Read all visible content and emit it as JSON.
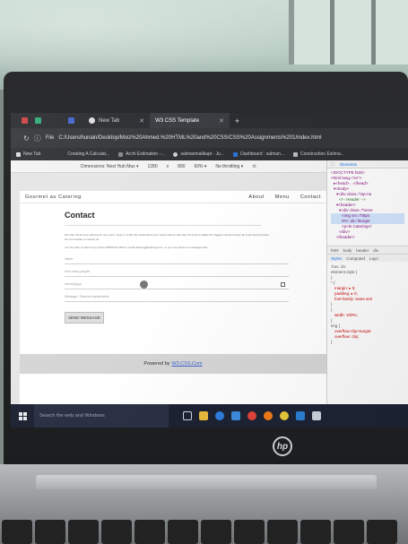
{
  "browser": {
    "tabs": [
      {
        "label": "New Tab",
        "active": false
      },
      {
        "label": "W3 CSS Template",
        "active": true
      }
    ],
    "file_label": "File",
    "url": "C:/Users/hunain/Desktop/Moiz%20Ahmed.%20HTML%20and%20CSS/CSS%20Assignments%201/index.html",
    "bookmarks": [
      {
        "label": "New Tab"
      },
      {
        "label": "Creating A Calculat..."
      },
      {
        "label": "Archi Estimation -..."
      },
      {
        "label": "salmanmalikapt - Ju..."
      },
      {
        "label": "Dashboard : salman..."
      },
      {
        "label": "Construction Estima..."
      }
    ]
  },
  "device_toolbar": {
    "dimensions_label": "Dimensions: Nest Hub Max ▾",
    "width": "1280",
    "times": "x",
    "height": "800",
    "zoom": "60% ▾",
    "throttle": "No throttling ▾"
  },
  "site": {
    "brand": "Gourmet au Catering",
    "nav": [
      "About",
      "Menu",
      "Contact"
    ],
    "contact": {
      "title": "Contact",
      "para1": "We offer full-service catering for any event, large or small. We understand your needs and we will cater the food to satisfy the biggest criteria of them all, both look and taste. Do not hesitate to contact us.",
      "para2": "You can also contact us by phone 00553123-2323 or email catering@catering.com, or you can send us a message here:",
      "fields": [
        "Name",
        "How many people",
        "mm/dd/yyyy",
        "Message \\ Special requirements"
      ],
      "send_label": "SEND MESSAGE"
    },
    "footer": {
      "text": "Powered by",
      "link": "W3.CSS.Com"
    }
  },
  "devtools": {
    "tabs": [
      "Elements"
    ],
    "code_lines": [
      "<!DOCTYPE html>",
      "<html lang=\"en\">",
      "▸<head>…</head>",
      "▾<body>",
      "▾<div class=\"top-na",
      "<!-- Header -->",
      "▾<header>",
      "▾<div class=\"home",
      "<img src=\"https",
      "0%\" alt=\"Burger",
      "<p>le Catering</",
      "</div>",
      "</header>"
    ],
    "sub_tabs": [
      "html",
      "body",
      "header",
      "div"
    ],
    "style_tabs": [
      "Styles",
      "Computed",
      "Layo"
    ],
    "style_lines": [
      ":hov .cls",
      "element.style {",
      "}",
      "* {",
      "margin: ▸ 0;",
      "padding: ▸ 0;",
      "font-family: Sans-seri",
      "}",
      "{",
      "width: 100%;",
      "}",
      "img {",
      "overflow-clip-margin:",
      "overflow: clip;",
      "}"
    ]
  },
  "taskbar": {
    "search_placeholder": "Search the web and Windows"
  },
  "laptop": {
    "logo": "hp"
  },
  "colors": {
    "taskbar": "#1d2333",
    "link": "#3a64c8",
    "tabbar": "#2b2d31"
  }
}
